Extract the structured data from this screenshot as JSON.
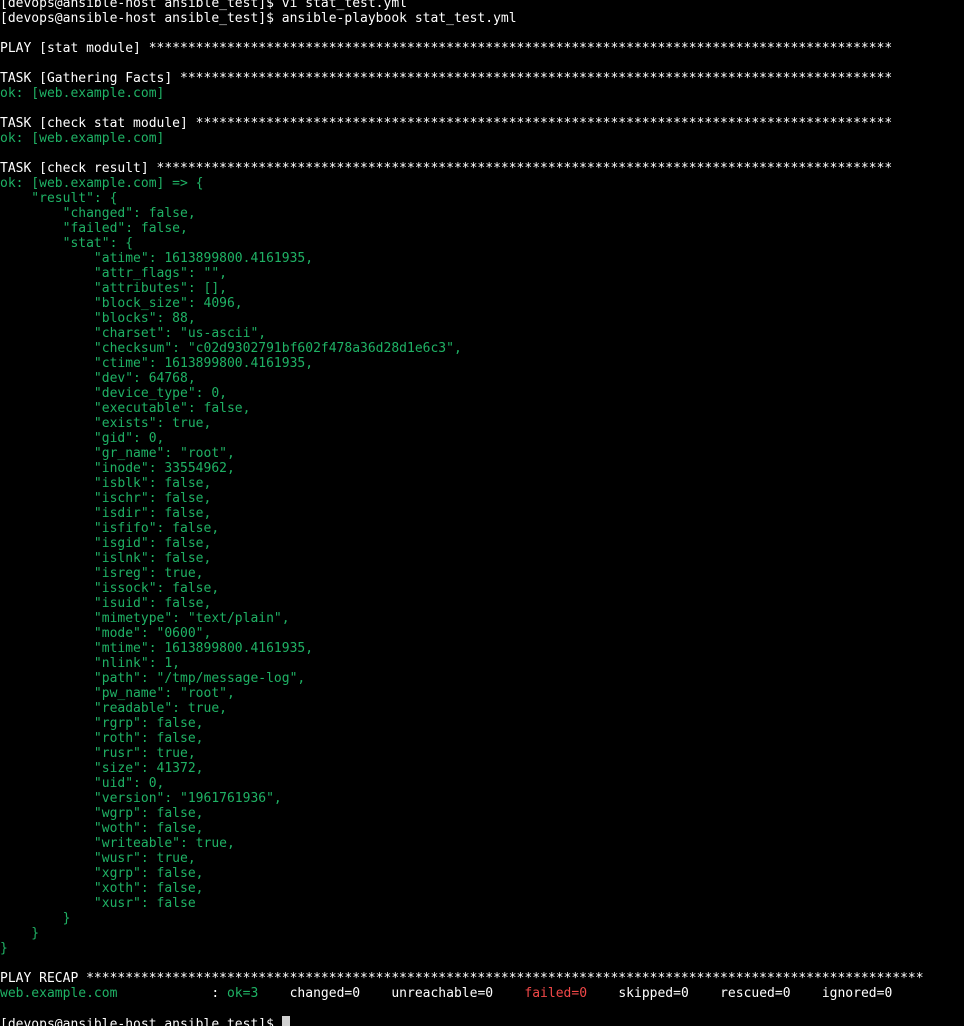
{
  "terminal": {
    "colors": {
      "default": "#ffffff",
      "ok": "#1fb265",
      "failed": "#f24848"
    },
    "lines": [
      [
        {
          "t": "[devops@ansible-host ansible_test]$ vi stat_test.yml",
          "c": "default"
        }
      ],
      [
        {
          "t": "[devops@ansible-host ansible_test]$ ansible-playbook stat_test.yml",
          "c": "default"
        }
      ],
      [],
      [
        {
          "t": "PLAY [stat module] ***********************************************************************************************",
          "c": "default"
        }
      ],
      [],
      [
        {
          "t": "TASK [Gathering Facts] *******************************************************************************************",
          "c": "default"
        }
      ],
      [
        {
          "t": "ok: [web.example.com]",
          "c": "ok"
        }
      ],
      [],
      [
        {
          "t": "TASK [check stat module] *****************************************************************************************",
          "c": "default"
        }
      ],
      [
        {
          "t": "ok: [web.example.com]",
          "c": "ok"
        }
      ],
      [],
      [
        {
          "t": "TASK [check result] **********************************************************************************************",
          "c": "default"
        }
      ],
      [
        {
          "t": "ok: [web.example.com] => {",
          "c": "ok"
        }
      ],
      [
        {
          "t": "    \"result\": {",
          "c": "ok"
        }
      ],
      [
        {
          "t": "        \"changed\": false,",
          "c": "ok"
        }
      ],
      [
        {
          "t": "        \"failed\": false,",
          "c": "ok"
        }
      ],
      [
        {
          "t": "        \"stat\": {",
          "c": "ok"
        }
      ],
      [
        {
          "t": "            \"atime\": 1613899800.4161935,",
          "c": "ok"
        }
      ],
      [
        {
          "t": "            \"attr_flags\": \"\",",
          "c": "ok"
        }
      ],
      [
        {
          "t": "            \"attributes\": [],",
          "c": "ok"
        }
      ],
      [
        {
          "t": "            \"block_size\": 4096,",
          "c": "ok"
        }
      ],
      [
        {
          "t": "            \"blocks\": 88,",
          "c": "ok"
        }
      ],
      [
        {
          "t": "            \"charset\": \"us-ascii\",",
          "c": "ok"
        }
      ],
      [
        {
          "t": "            \"checksum\": \"c02d9302791bf602f478a36d28d1e6c3\",",
          "c": "ok"
        }
      ],
      [
        {
          "t": "            \"ctime\": 1613899800.4161935,",
          "c": "ok"
        }
      ],
      [
        {
          "t": "            \"dev\": 64768,",
          "c": "ok"
        }
      ],
      [
        {
          "t": "            \"device_type\": 0,",
          "c": "ok"
        }
      ],
      [
        {
          "t": "            \"executable\": false,",
          "c": "ok"
        }
      ],
      [
        {
          "t": "            \"exists\": true,",
          "c": "ok"
        }
      ],
      [
        {
          "t": "            \"gid\": 0,",
          "c": "ok"
        }
      ],
      [
        {
          "t": "            \"gr_name\": \"root\",",
          "c": "ok"
        }
      ],
      [
        {
          "t": "            \"inode\": 33554962,",
          "c": "ok"
        }
      ],
      [
        {
          "t": "            \"isblk\": false,",
          "c": "ok"
        }
      ],
      [
        {
          "t": "            \"ischr\": false,",
          "c": "ok"
        }
      ],
      [
        {
          "t": "            \"isdir\": false,",
          "c": "ok"
        }
      ],
      [
        {
          "t": "            \"isfifo\": false,",
          "c": "ok"
        }
      ],
      [
        {
          "t": "            \"isgid\": false,",
          "c": "ok"
        }
      ],
      [
        {
          "t": "            \"islnk\": false,",
          "c": "ok"
        }
      ],
      [
        {
          "t": "            \"isreg\": true,",
          "c": "ok"
        }
      ],
      [
        {
          "t": "            \"issock\": false,",
          "c": "ok"
        }
      ],
      [
        {
          "t": "            \"isuid\": false,",
          "c": "ok"
        }
      ],
      [
        {
          "t": "            \"mimetype\": \"text/plain\",",
          "c": "ok"
        }
      ],
      [
        {
          "t": "            \"mode\": \"0600\",",
          "c": "ok"
        }
      ],
      [
        {
          "t": "            \"mtime\": 1613899800.4161935,",
          "c": "ok"
        }
      ],
      [
        {
          "t": "            \"nlink\": 1,",
          "c": "ok"
        }
      ],
      [
        {
          "t": "            \"path\": \"/tmp/message-log\",",
          "c": "ok"
        }
      ],
      [
        {
          "t": "            \"pw_name\": \"root\",",
          "c": "ok"
        }
      ],
      [
        {
          "t": "            \"readable\": true,",
          "c": "ok"
        }
      ],
      [
        {
          "t": "            \"rgrp\": false,",
          "c": "ok"
        }
      ],
      [
        {
          "t": "            \"roth\": false,",
          "c": "ok"
        }
      ],
      [
        {
          "t": "            \"rusr\": true,",
          "c": "ok"
        }
      ],
      [
        {
          "t": "            \"size\": 41372,",
          "c": "ok"
        }
      ],
      [
        {
          "t": "            \"uid\": 0,",
          "c": "ok"
        }
      ],
      [
        {
          "t": "            \"version\": \"1961761936\",",
          "c": "ok"
        }
      ],
      [
        {
          "t": "            \"wgrp\": false,",
          "c": "ok"
        }
      ],
      [
        {
          "t": "            \"woth\": false,",
          "c": "ok"
        }
      ],
      [
        {
          "t": "            \"writeable\": true,",
          "c": "ok"
        }
      ],
      [
        {
          "t": "            \"wusr\": true,",
          "c": "ok"
        }
      ],
      [
        {
          "t": "            \"xgrp\": false,",
          "c": "ok"
        }
      ],
      [
        {
          "t": "            \"xoth\": false,",
          "c": "ok"
        }
      ],
      [
        {
          "t": "            \"xusr\": false",
          "c": "ok"
        }
      ],
      [
        {
          "t": "        }",
          "c": "ok"
        }
      ],
      [
        {
          "t": "    }",
          "c": "ok"
        }
      ],
      [
        {
          "t": "}",
          "c": "ok"
        }
      ],
      [],
      [
        {
          "t": "PLAY RECAP ***********************************************************************************************************",
          "c": "default"
        }
      ],
      [
        {
          "t": "web.example.com",
          "c": "ok"
        },
        {
          "t": "            : ",
          "c": "default"
        },
        {
          "t": "ok=3",
          "c": "ok"
        },
        {
          "t": "    changed=0    unreachable=0    ",
          "c": "default"
        },
        {
          "t": "failed=0",
          "c": "failed"
        },
        {
          "t": "    skipped=0    rescued=0    ignored=0",
          "c": "default"
        }
      ],
      [],
      [
        {
          "t": "[devops@ansible-host ansible_test]$ ",
          "c": "default"
        }
      ]
    ]
  }
}
